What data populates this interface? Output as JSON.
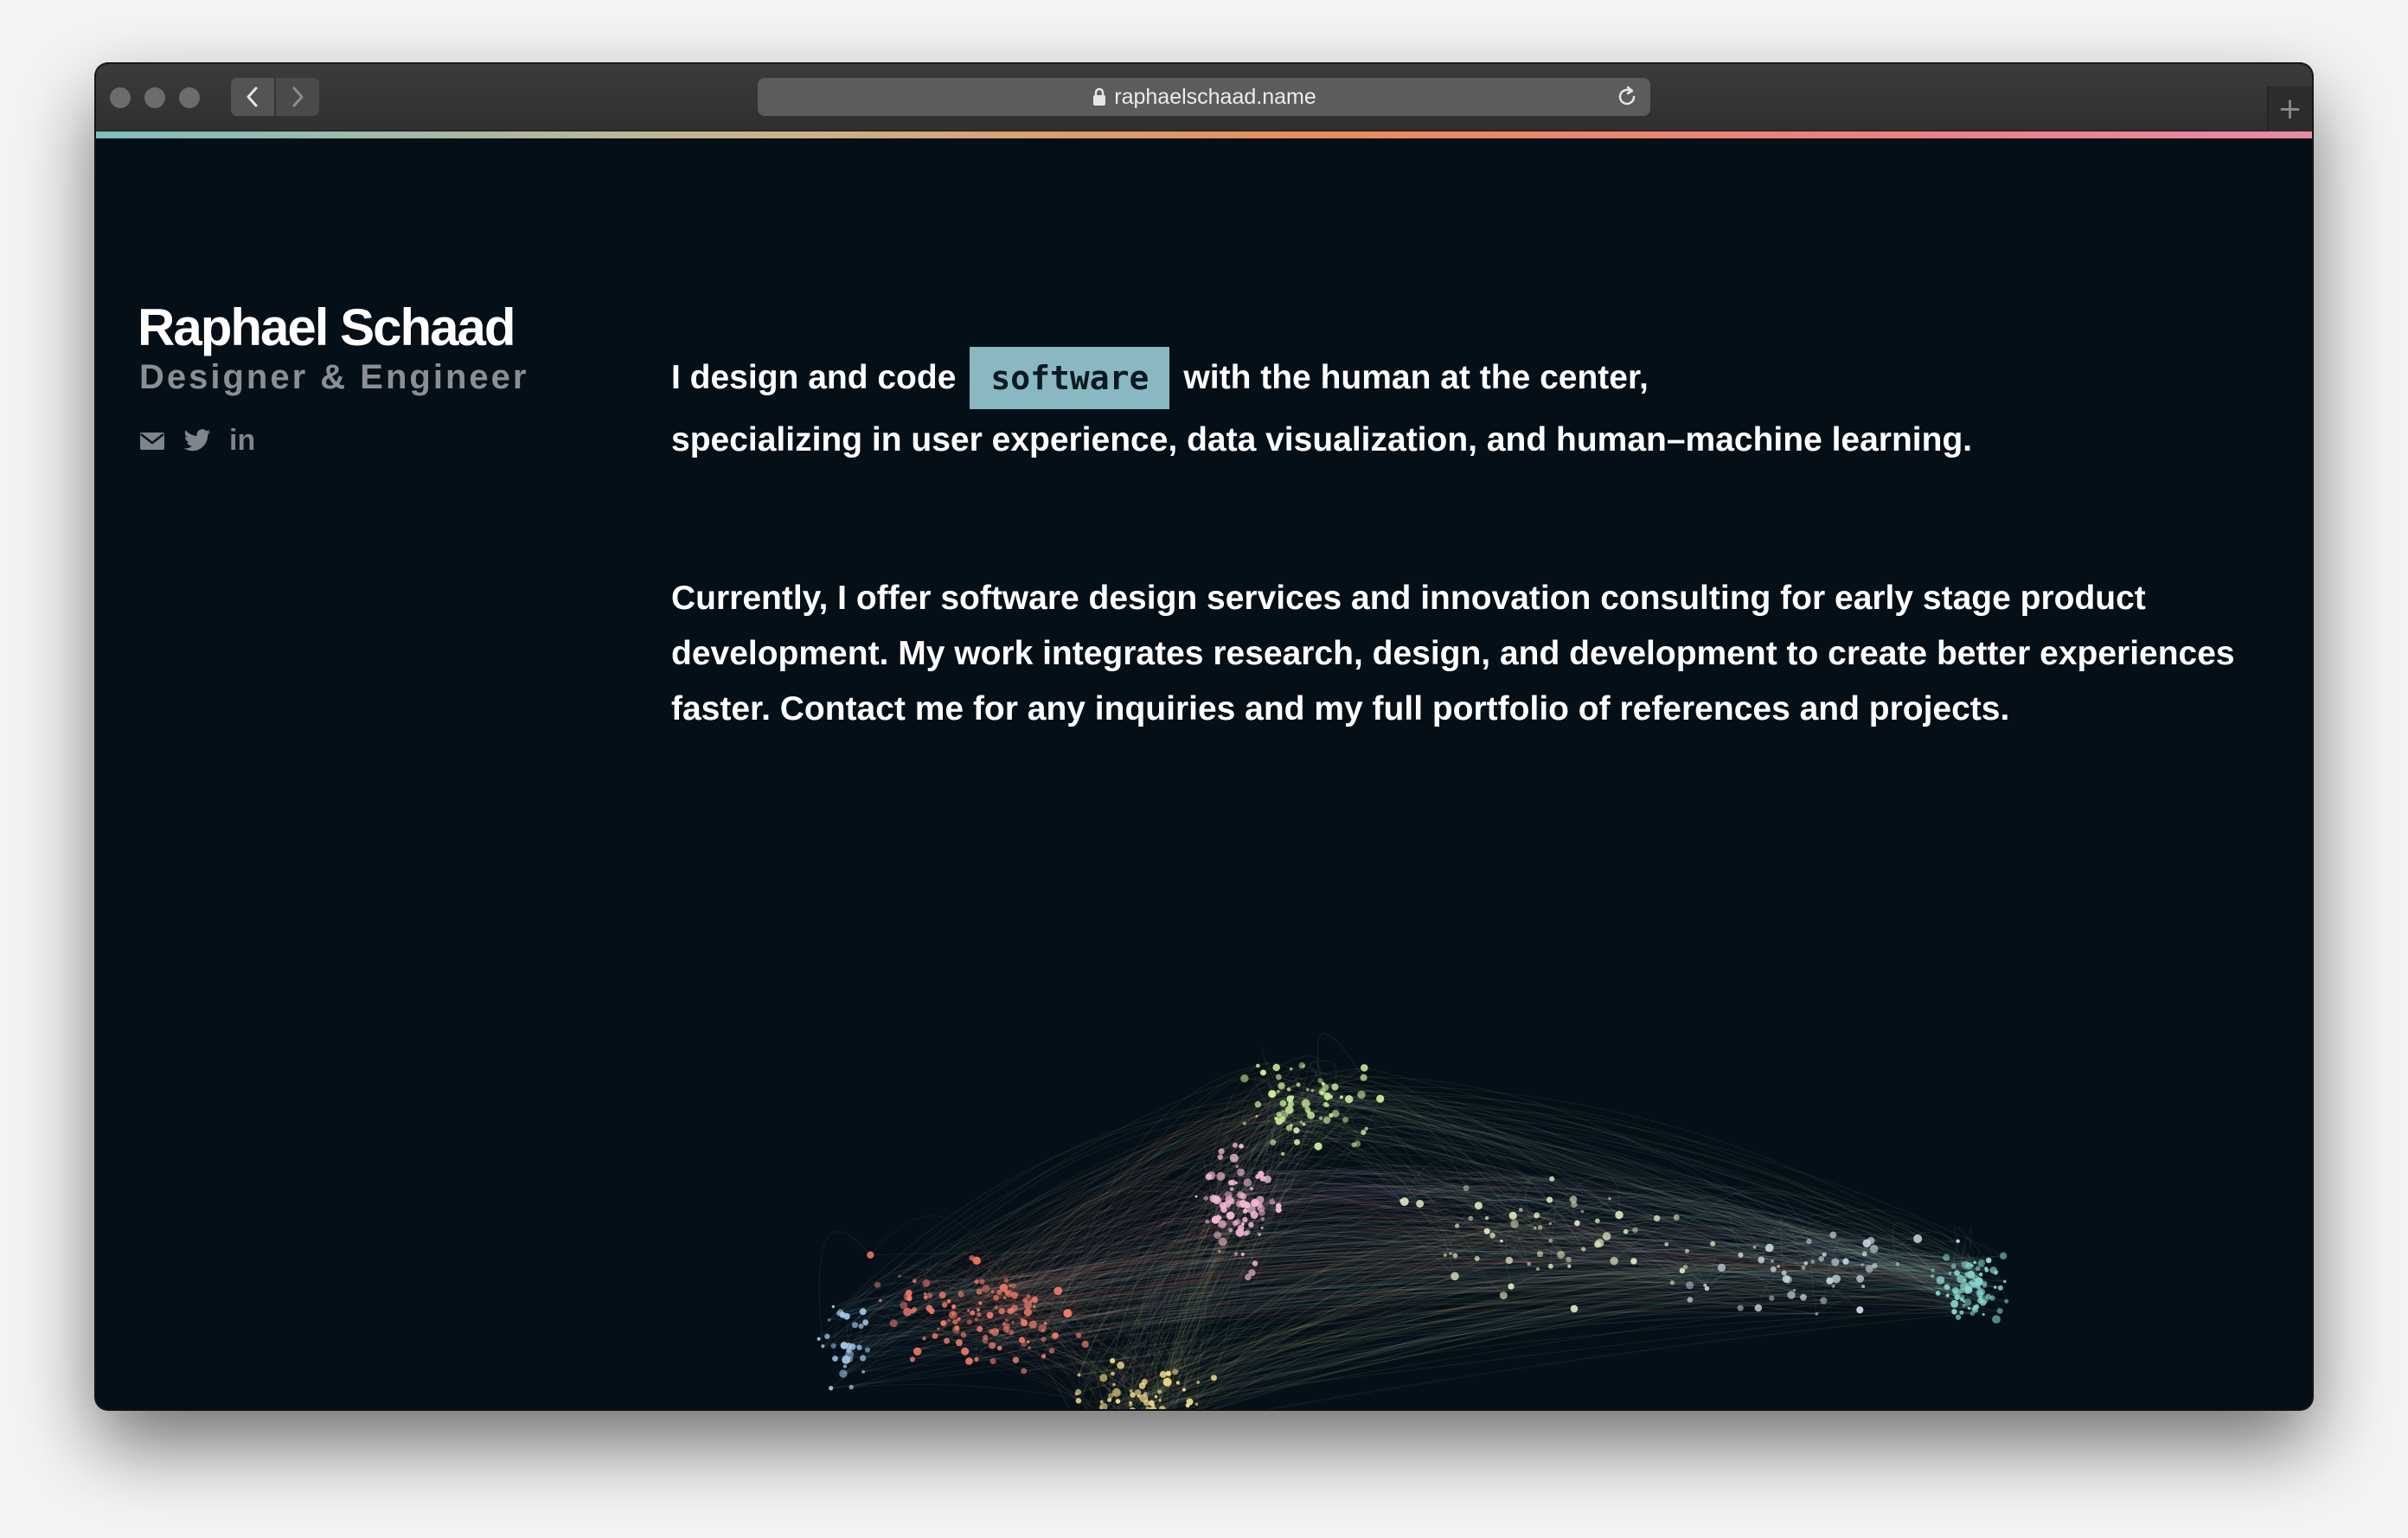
{
  "browser": {
    "url": "raphaelschaad.name",
    "icons": {
      "lock": "lock-icon",
      "reload": "reload-icon",
      "back": "chevron-left-icon",
      "forward": "chevron-right-icon",
      "newtab": "plus-icon"
    },
    "newtab_label": "+"
  },
  "profile": {
    "name": "Raphael Schaad",
    "role": "Designer & Engineer",
    "social": [
      "mail-icon",
      "twitter-icon",
      "linkedin-icon"
    ],
    "linkedin_label": "in"
  },
  "intro": {
    "before": "I design and code",
    "tag": "software",
    "after": "with the human at the center,",
    "line2": "specializing in user experience, data visualization, and human–machine learning."
  },
  "about": {
    "text": "Currently, I offer software design services and innovation consulting for early stage product development. My work integrates research, design, and development to create better experiences faster. Contact me for any inquiries and my full portfolio of references and projects."
  },
  "colors": {
    "background": "#050f17",
    "tag": "#8ab8c2",
    "accent_gradient": [
      "#7fbfbf",
      "#c9b48a",
      "#e98d5a",
      "#ee7f80",
      "#e98aa6"
    ],
    "clusters": [
      "#f07a68",
      "#f5e08a",
      "#f2b6d4",
      "#c7e89a",
      "#88d8d2",
      "#9fc7e6"
    ]
  }
}
